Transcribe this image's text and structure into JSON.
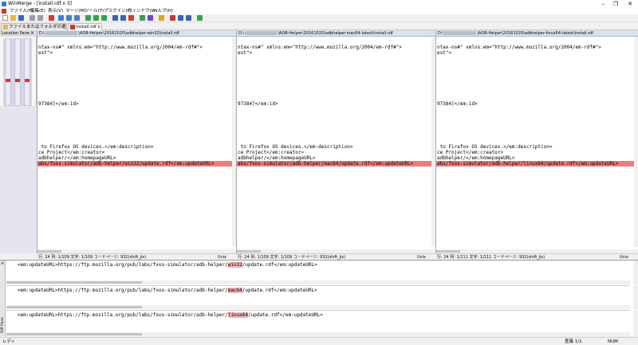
{
  "window": {
    "title": "WinMerge - [install.rdf x 3]",
    "minimize": "–",
    "maximize": "❐",
    "close": "✕"
  },
  "menu": [
    "ファイル(F)",
    "編集(E)",
    "表示(V)",
    "マージ(M)",
    "ツール(T)",
    "プラグイン(P)",
    "ウィンドウ(W)",
    "ヘルプ(H)"
  ],
  "tabs": [
    {
      "label": "ファイルまたはフォルダの選択..."
    },
    {
      "label": "install.rdf x 3"
    }
  ],
  "location_pane": {
    "title": "Location Pane",
    "close": "×"
  },
  "panes": [
    {
      "path_prefix": "D:\\",
      "path_suffix": "\\ADB-Helper\\20161020\\adbhelper-win32\\install.rdf",
      "line1": "ntax-ns#\" xmlns:em=\"http://www.mozilla.org/2004/em-rdf#\">",
      "line2": "est\">",
      "line3": "97384]</em:id>",
      "line4": " to Firefox OS devices.</em:description>",
      "line5": "ce Project</em:creator>",
      "line6": "adbhelper/</em:homepageURL>",
      "diff_pre": "abs/fxos-simulator/adb-helper/",
      "diff_word": "win32",
      "diff_post": "/update.rdf</em:updateURL>",
      "status": "行: 24  列: 1/109  文字: 1/109  コードページ: 932(shift_jis)",
      "eol": "Unix"
    },
    {
      "path_prefix": "D:\\",
      "path_suffix": "\\ADB-Helper\\20161020\\adbhelper-mac64-latest\\install.rdf",
      "line1": "ntax-ns#\" xmlns:em=\"http://www.mozilla.org/2004/em-rdf#\">",
      "line2": "est\">",
      "line3": "97384]</em:id>",
      "line4": " to Firefox OS devices.</em:description>",
      "line5": "ce Project</em:creator>",
      "line6": "adbhelper/</em:homepageURL>",
      "diff_pre": "abs/fxos-simulator/adb-helper/",
      "diff_word": "mac64",
      "diff_post": "/update.rdf</em:updateURL>",
      "status": "行: 24  列: 1/109  文字: 1/109  コードページ: 932(shift_jis)",
      "eol": "Unix"
    },
    {
      "path_prefix": "D:\\",
      "path_suffix": "\\ADB-Helper\\20161020\\adbhelper-linux64-latest\\install.rdf",
      "line1": "ntax-ns#\" xmlns:em=\"http://www.mozilla.org/2004/em-rdf#\">",
      "line2": "est\">",
      "line3": "97384]</em:id>",
      "line4": " to Firefox OS devices.</em:description>",
      "line5": "ce Project</em:creator>",
      "line6": "adbhelper/</em:homepageURL>",
      "diff_pre": "abs/fxos-simulator/adb-helper/",
      "diff_word": "linux64",
      "diff_post": "/update.rdf</em:updateURL>",
      "status": "行: 24  列: 1/111  文字: 1/111  コードページ: 932(shift_jis)",
      "eol": "Unix"
    }
  ],
  "diff_pane": {
    "label": "Diff Pane",
    "close": "×",
    "rows": [
      {
        "pre": "<em:updateURL>https://ftp.mozilla.org/pub/labs/fxos-simulator/adb-helper/",
        "word": "win32",
        "post": "/update.rdf</em:updateURL>"
      },
      {
        "pre": "<em:updateURL>https://ftp.mozilla.org/pub/labs/fxos-simulator/adb-helper/",
        "word": "mac64",
        "post": "/update.rdf</em:updateURL>"
      },
      {
        "pre": "<em:updateURL>https://ftp.mozilla.org/pub/labs/fxos-simulator/adb-helper/",
        "word": "linux64",
        "post": "/update.rdf</em:updateURL>"
      }
    ]
  },
  "statusbar": {
    "ready": "レディ",
    "diff_count": "差異 1/1",
    "num": "NUM"
  },
  "colors": {
    "diff_line": "#f07a7a",
    "diff_word": "#f0b4b4",
    "path_header": "#d9e2ec"
  },
  "icons": [
    "new-icon",
    "open-icon",
    "save-icon",
    "undo-icon",
    "redo-icon",
    "diff-icon",
    "merge-icon",
    "refresh-icon",
    "options-icon"
  ]
}
